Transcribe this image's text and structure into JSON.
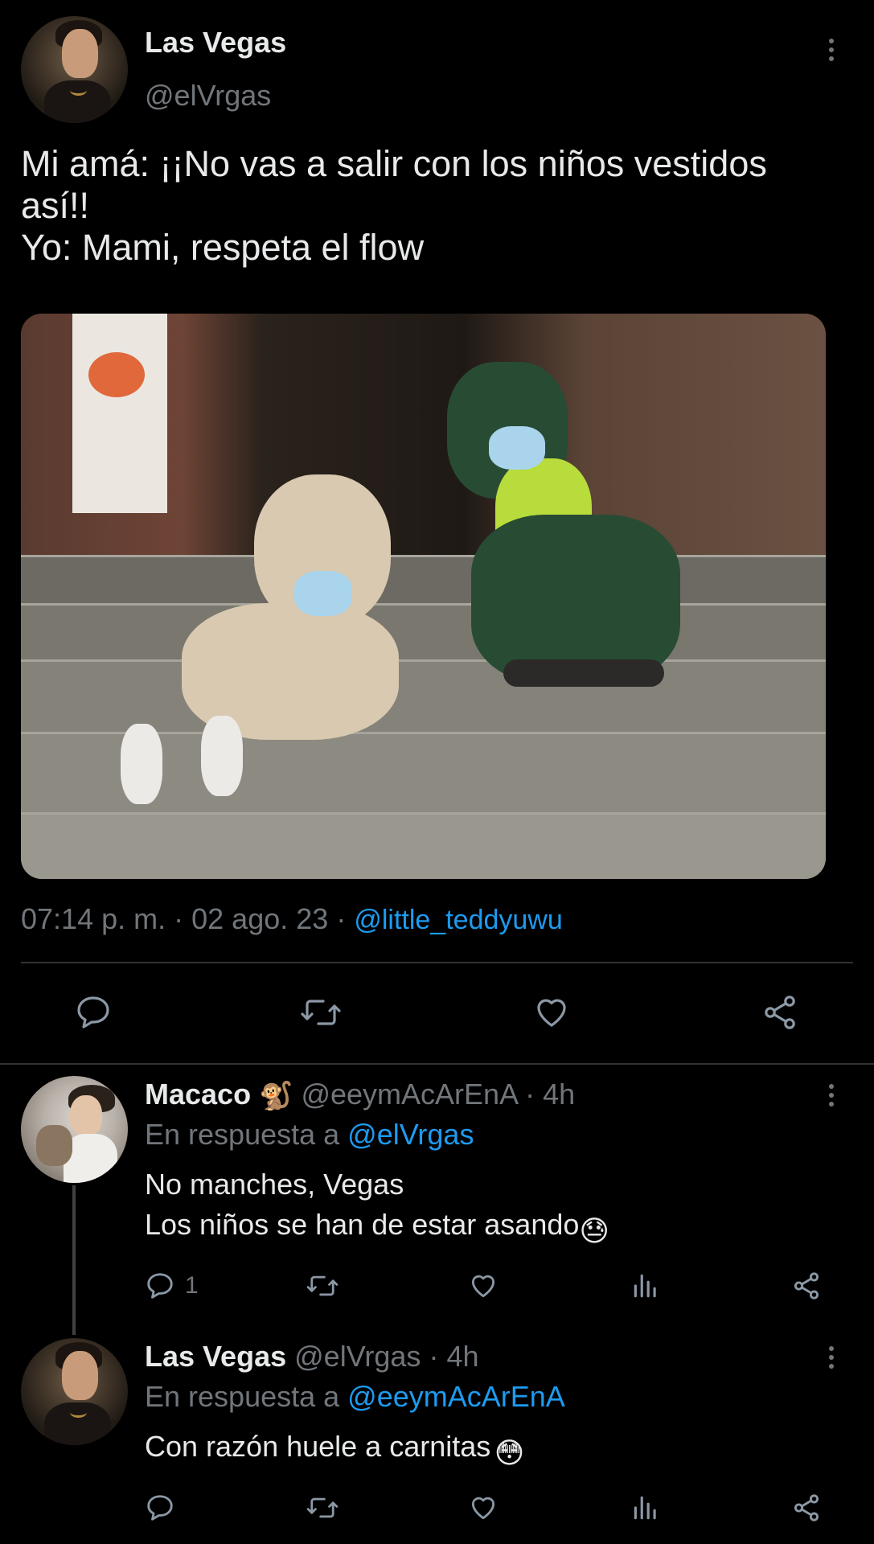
{
  "tweet": {
    "author_name": "Las Vegas",
    "author_handle": "@elVrgas",
    "text": "Mi amá: ¡¡No vas a salir con los niños vestidos así!!\nYo: Mami, respeta el flow",
    "time": "07:14 p. m.",
    "date": "02 ago. 23",
    "via_handle": "@little_teddyuwu",
    "sep": "·",
    "actions": [
      "reply-icon",
      "retweet-icon",
      "like-icon",
      "share-icon"
    ]
  },
  "replies": [
    {
      "name": "Macaco",
      "name_emoji": "🐒",
      "handle": "@eeymAcArEnA",
      "age": "4h",
      "replying_prefix": "En respuesta a",
      "replying_to": "@elVrgas",
      "text": "No manches, Vegas\nLos niños se han de estar asando",
      "text_emoji": "😓",
      "reply_count": "1"
    },
    {
      "name": "Las Vegas",
      "handle": "@elVrgas",
      "age": "4h",
      "replying_prefix": "En respuesta a",
      "replying_to": "@eeymAcArEnA",
      "text": "Con razón huele a carnitas",
      "text_emoji": "😳",
      "reply_count": ""
    }
  ],
  "colors": {
    "background": "#000000",
    "text": "#e7e9ea",
    "muted": "#71767b",
    "link": "#1d9bf0",
    "divider": "#2f3336"
  }
}
